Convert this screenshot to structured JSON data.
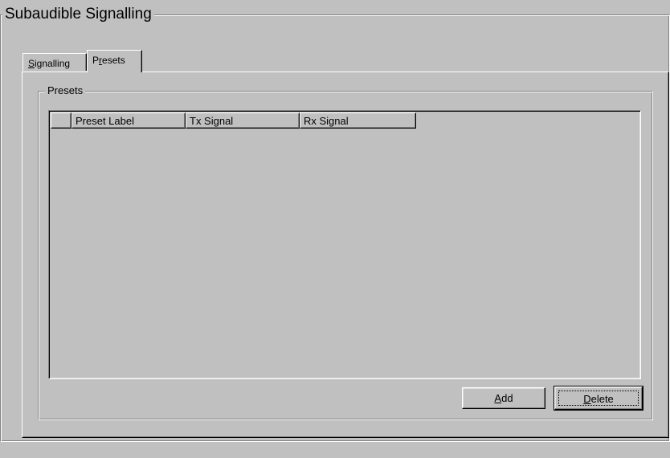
{
  "window": {
    "group_title": "Subaudible Signalling"
  },
  "tabs": [
    {
      "label_pre": "",
      "label_ul": "S",
      "label_post": "ignalling",
      "active": false
    },
    {
      "label_pre": "P",
      "label_ul": "r",
      "label_post": "esets",
      "active": true
    }
  ],
  "presets": {
    "group_title": "Presets",
    "columns": [
      "",
      "Preset Label",
      "Tx Signal",
      "Rx Signal"
    ],
    "rows": []
  },
  "buttons": {
    "add": {
      "ul": "A",
      "rest": "dd"
    },
    "delete": {
      "ul": "D",
      "rest": "elete"
    }
  }
}
